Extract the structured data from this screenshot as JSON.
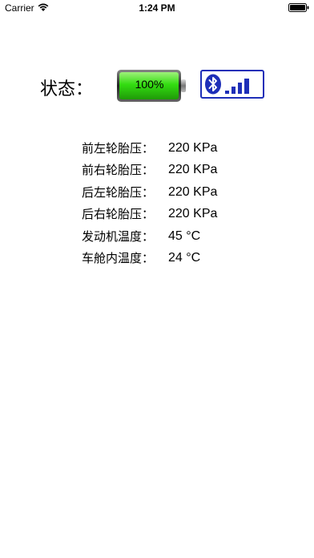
{
  "status_bar": {
    "carrier": "Carrier",
    "time": "1:24 PM",
    "wifi_icon": "wifi-icon",
    "battery_icon": "battery-icon"
  },
  "status": {
    "label": "状态：",
    "battery_percent": "100%",
    "battery_level": 1.0,
    "battery_color": "#33dd11",
    "bluetooth_icon": "bluetooth-icon",
    "signal_icon": "signal-bars-icon",
    "signal_level": 4,
    "accent_color": "#1e2fb8"
  },
  "readings": [
    {
      "label": "前左轮胎压：",
      "value": "220 KPa"
    },
    {
      "label": "前右轮胎压：",
      "value": "220 KPa"
    },
    {
      "label": "后左轮胎压：",
      "value": "220 KPa"
    },
    {
      "label": "后右轮胎压：",
      "value": "220 KPa"
    },
    {
      "label": "发动机温度：",
      "value": "45 °C"
    },
    {
      "label": "车舱内温度：",
      "value": "24 °C"
    }
  ]
}
